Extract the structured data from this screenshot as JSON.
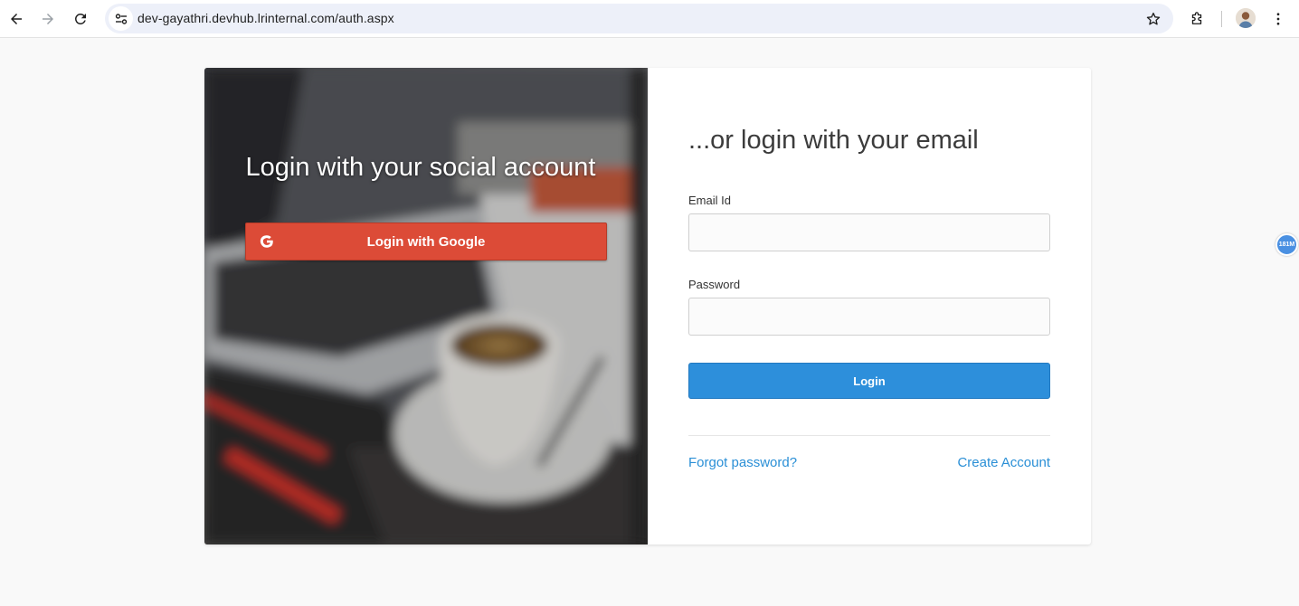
{
  "browser": {
    "url": "dev-gayathri.devhub.lrinternal.com/auth.aspx",
    "icons": {
      "back": "back-arrow-icon",
      "forward": "forward-arrow-icon",
      "reload": "reload-icon",
      "site_info": "site-info-icon",
      "bookmark": "star-icon",
      "extensions": "puzzle-icon",
      "menu": "kebab-icon"
    }
  },
  "social": {
    "title": "Login with your social account",
    "google_label": "Login with Google",
    "google_color": "#dc4b37"
  },
  "email_login": {
    "title": "...or login with your email",
    "email_label": "Email Id",
    "email_value": "",
    "password_label": "Password",
    "password_value": "",
    "login_label": "Login",
    "login_color": "#2d8fdb",
    "forgot_label": "Forgot password?",
    "create_label": "Create Account",
    "link_color": "#2a8fd6"
  },
  "badge": {
    "label": "181M"
  }
}
